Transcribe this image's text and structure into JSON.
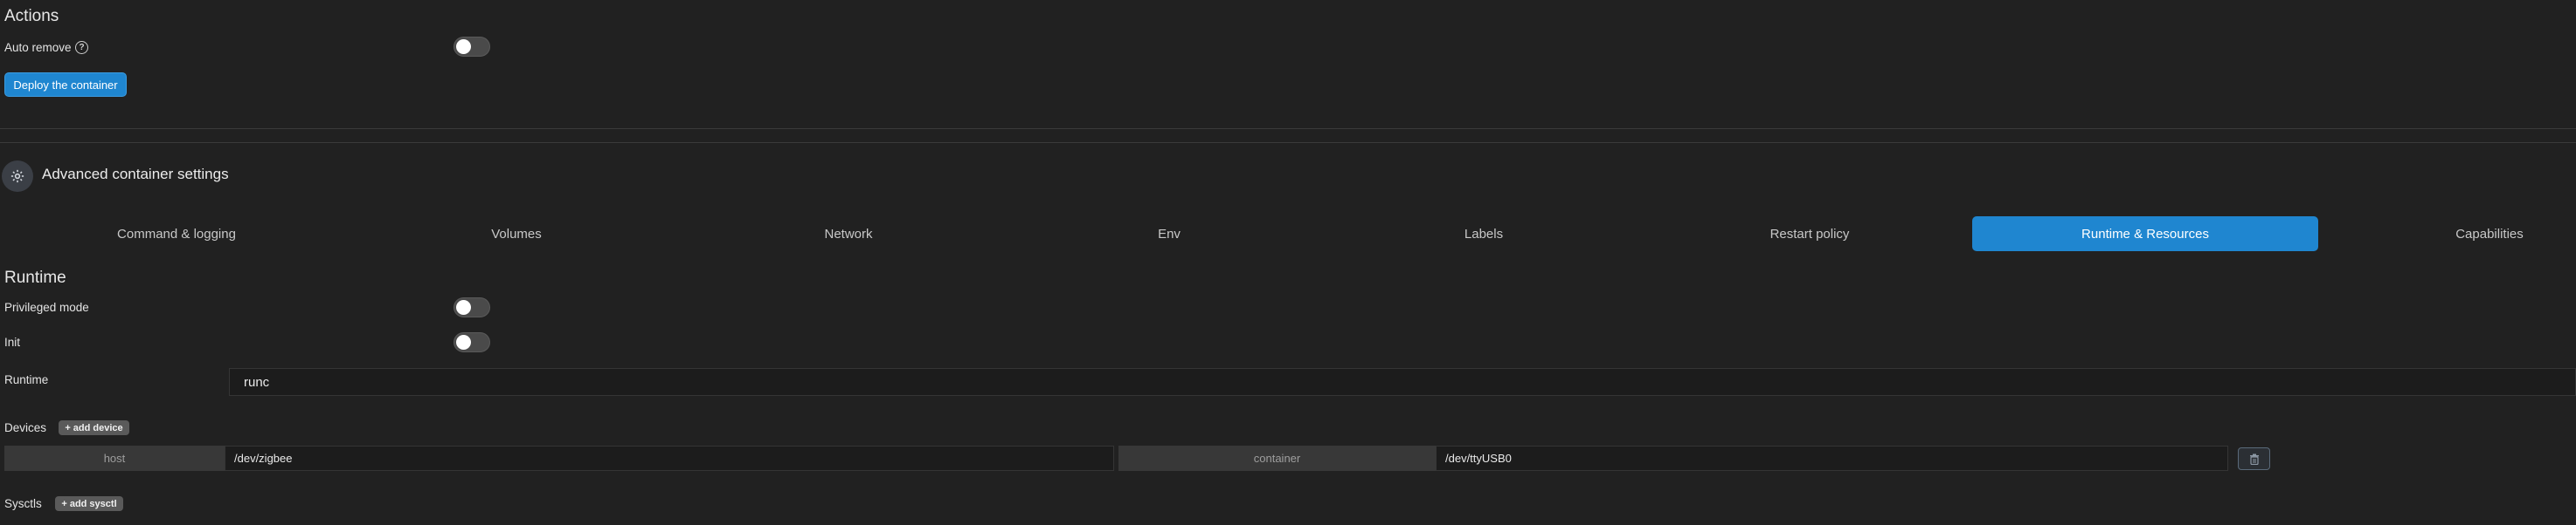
{
  "actions": {
    "title": "Actions",
    "auto_remove_label": "Auto remove",
    "auto_remove_help": "?",
    "deploy_label": "Deploy the container"
  },
  "advanced": {
    "title": "Advanced container settings",
    "tabs": [
      {
        "label": "Command & logging",
        "active": false
      },
      {
        "label": "Volumes",
        "active": false
      },
      {
        "label": "Network",
        "active": false
      },
      {
        "label": "Env",
        "active": false
      },
      {
        "label": "Labels",
        "active": false
      },
      {
        "label": "Restart policy",
        "active": false
      },
      {
        "label": "Runtime & Resources",
        "active": true
      },
      {
        "label": "Capabilities",
        "active": false
      }
    ]
  },
  "runtime": {
    "title": "Runtime",
    "privileged_label": "Privileged mode",
    "init_label": "Init",
    "runtime_label": "Runtime",
    "runtime_value": "runc"
  },
  "devices": {
    "label": "Devices",
    "add_label": "+ add device",
    "rows": [
      {
        "host_label": "host",
        "host_value": "/dev/zigbee",
        "container_label": "container",
        "container_value": "/dev/ttyUSB0"
      }
    ]
  },
  "sysctls": {
    "label": "Sysctls",
    "add_label": "+ add sysctl"
  },
  "colors": {
    "accent": "#1f86d0",
    "background": "#212121"
  }
}
